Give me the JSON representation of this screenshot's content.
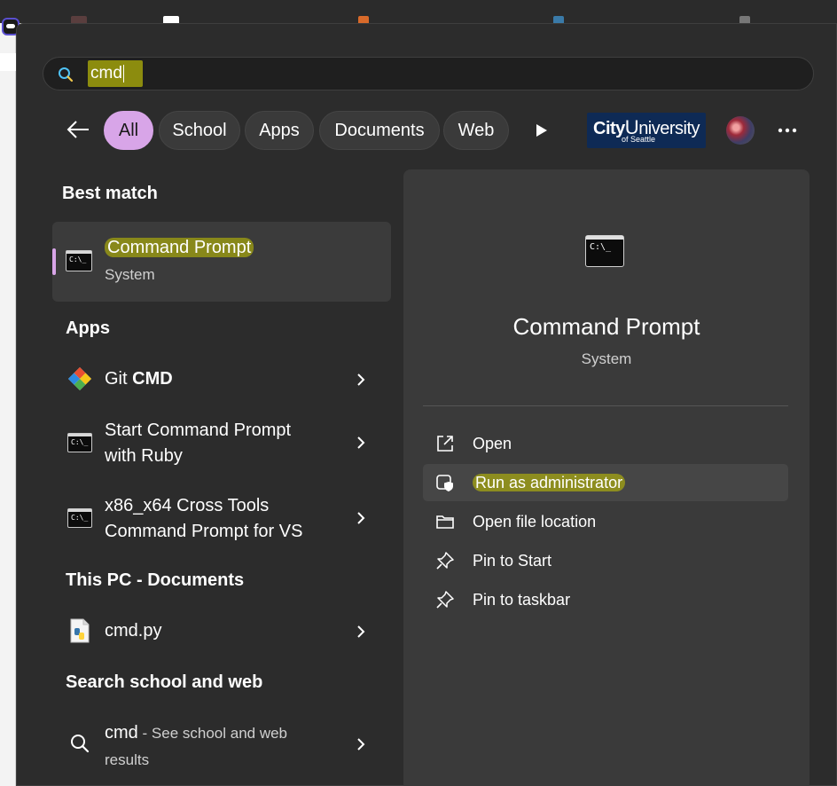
{
  "search": {
    "value": "cmd"
  },
  "filters": {
    "chips": [
      "All",
      "School",
      "Apps",
      "Documents",
      "Web"
    ],
    "active": "All"
  },
  "account": {
    "logo_line1_a": "City",
    "logo_line1_b": "U",
    "logo_line1_c": "niversity",
    "logo_line2": "of Seattle"
  },
  "best_match": {
    "heading": "Best match",
    "title": "Command Prompt",
    "subtitle": "System"
  },
  "apps": {
    "heading": "Apps",
    "items": [
      {
        "title_prefix": "Git ",
        "title_bold": "CMD",
        "line2": "",
        "icon": "git-icon"
      },
      {
        "title_prefix": "Start Command Prompt",
        "title_bold": "",
        "line2": "with Ruby",
        "icon": "terminal-icon"
      },
      {
        "title_prefix": "x86_x64 Cross Tools",
        "title_bold": "",
        "line2": "Command Prompt for VS",
        "icon": "terminal-icon"
      }
    ]
  },
  "documents": {
    "heading": "This PC - Documents",
    "items": [
      {
        "title": "cmd.py",
        "icon": "python-file-icon"
      }
    ]
  },
  "web": {
    "heading": "Search school and web",
    "query": "cmd",
    "suffix": " - See school and web",
    "line2": "results"
  },
  "details": {
    "title": "Command Prompt",
    "subtitle": "System",
    "actions": [
      {
        "label": "Open",
        "icon": "open-external-icon"
      },
      {
        "label": "Run as administrator",
        "icon": "shield-admin-icon"
      },
      {
        "label": "Open file location",
        "icon": "folder-icon"
      },
      {
        "label": "Pin to Start",
        "icon": "pin-icon"
      },
      {
        "label": "Pin to taskbar",
        "icon": "pin-icon"
      }
    ]
  },
  "colors": {
    "panel": "#2c2c2c",
    "accent": "#d8a5e8",
    "highlight": "#c8c800",
    "detail_panel": "#3a3a3a"
  }
}
